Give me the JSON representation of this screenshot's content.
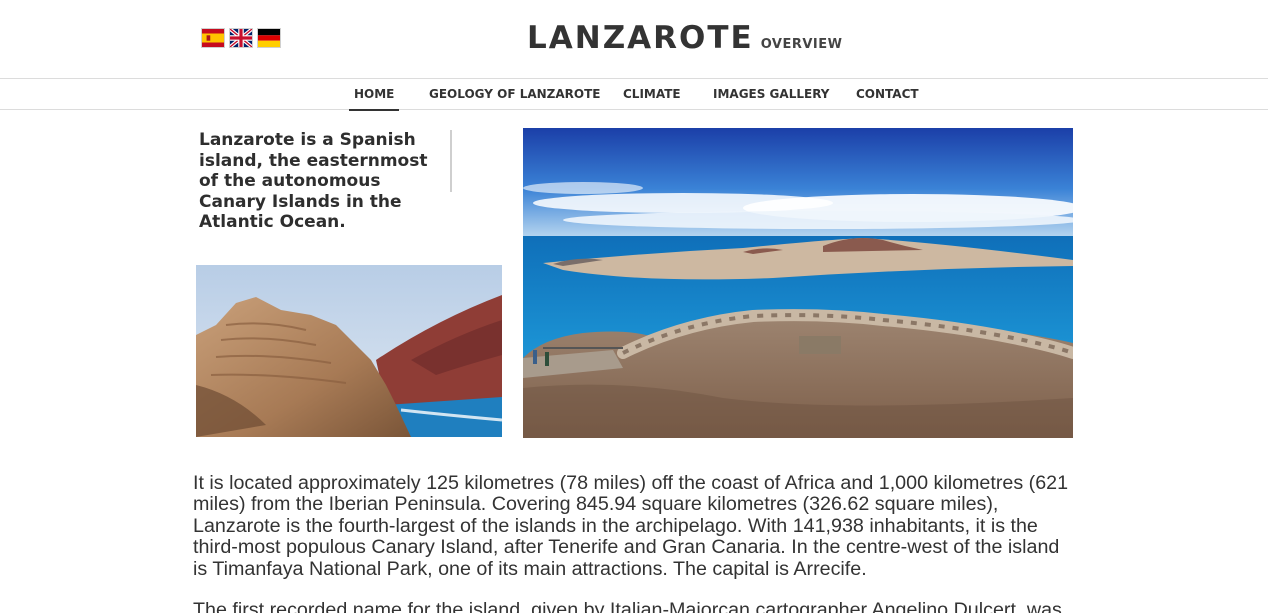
{
  "languages": [
    {
      "code": "es",
      "icon": "spain-flag-icon"
    },
    {
      "code": "en",
      "icon": "uk-flag-icon"
    },
    {
      "code": "de",
      "icon": "germany-flag-icon"
    }
  ],
  "header": {
    "title": "LANZAROTE",
    "subtitle": "OVERVIEW"
  },
  "nav": {
    "items": [
      {
        "label": "HOME",
        "active": true
      },
      {
        "label": "GEOLOGY OF LANZAROTE",
        "active": false
      },
      {
        "label": "CLIMATE",
        "active": false
      },
      {
        "label": "IMAGES GALLERY",
        "active": false
      },
      {
        "label": "CONTACT",
        "active": false
      }
    ]
  },
  "intro": "Lanzarote is a Spanish island, the easternmost of the autonomous Canary Islands in the Atlantic Ocean.",
  "paragraphs": [
    "It is located approximately 125 kilometres (78 miles) off the coast of Africa and 1,000 kilometres (621 miles) from the Iberian Peninsula. Covering 845.94 square kilometres (326.62 square miles), Lanzarote is the fourth-largest of the islands in the archipelago. With 141,938 inhabitants, it is the third-most populous Canary Island, after Tenerife and Gran Canaria. In the centre-west of the island is Timanfaya National Park, one of its main attractions. The capital is Arrecife.",
    "The first recorded name for the island, given by Italian-Majorcan cartographer Angelino Dulcert, was"
  ],
  "colors": {
    "text": "#333333",
    "divider": "#dcdcdc",
    "sea": "#1a7fc4",
    "sky": "#1f5fc0"
  }
}
